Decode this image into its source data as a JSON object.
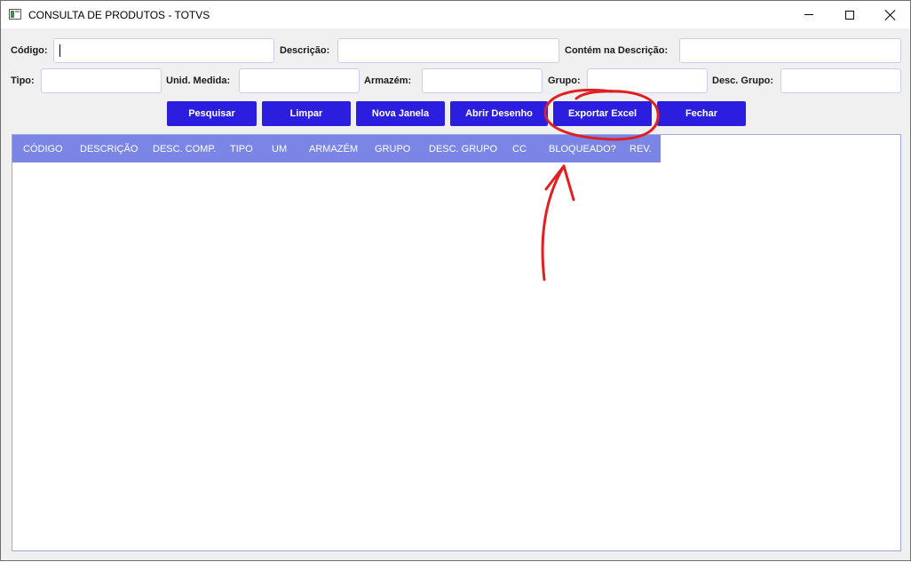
{
  "window": {
    "title": "CONSULTA DE PRODUTOS - TOTVS",
    "controls": {
      "minimize": "minimize-icon",
      "maximize": "maximize-icon",
      "close": "close-icon"
    }
  },
  "filters": {
    "codigo": {
      "label": "Código:",
      "value": ""
    },
    "descricao": {
      "label": "Descrição:",
      "value": ""
    },
    "contem_descricao": {
      "label": "Contém na Descrição:",
      "value": ""
    },
    "tipo": {
      "label": "Tipo:",
      "value": ""
    },
    "unid_medida": {
      "label": "Unid. Medida:",
      "value": ""
    },
    "armazem": {
      "label": "Armazém:",
      "value": ""
    },
    "grupo": {
      "label": "Grupo:",
      "value": ""
    },
    "desc_grupo": {
      "label": "Desc. Grupo:",
      "value": ""
    }
  },
  "buttons": {
    "pesquisar": "Pesquisar",
    "limpar": "Limpar",
    "nova_janela": "Nova Janela",
    "abrir_desenho": "Abrir Desenho",
    "exportar_excel": "Exportar Excel",
    "fechar": "Fechar"
  },
  "grid": {
    "columns": [
      "CÓDIGO",
      "DESCRIÇÃO",
      "DESC. COMP.",
      "TIPO",
      "UM",
      "ARMAZÉM",
      "GRUPO",
      "DESC. GRUPO",
      "CC",
      "BLOQUEADO?",
      "REV."
    ],
    "rows": []
  },
  "colors": {
    "button": "#2b1edf",
    "grid_header": "#7a85e6",
    "annotation": "#e02020"
  }
}
